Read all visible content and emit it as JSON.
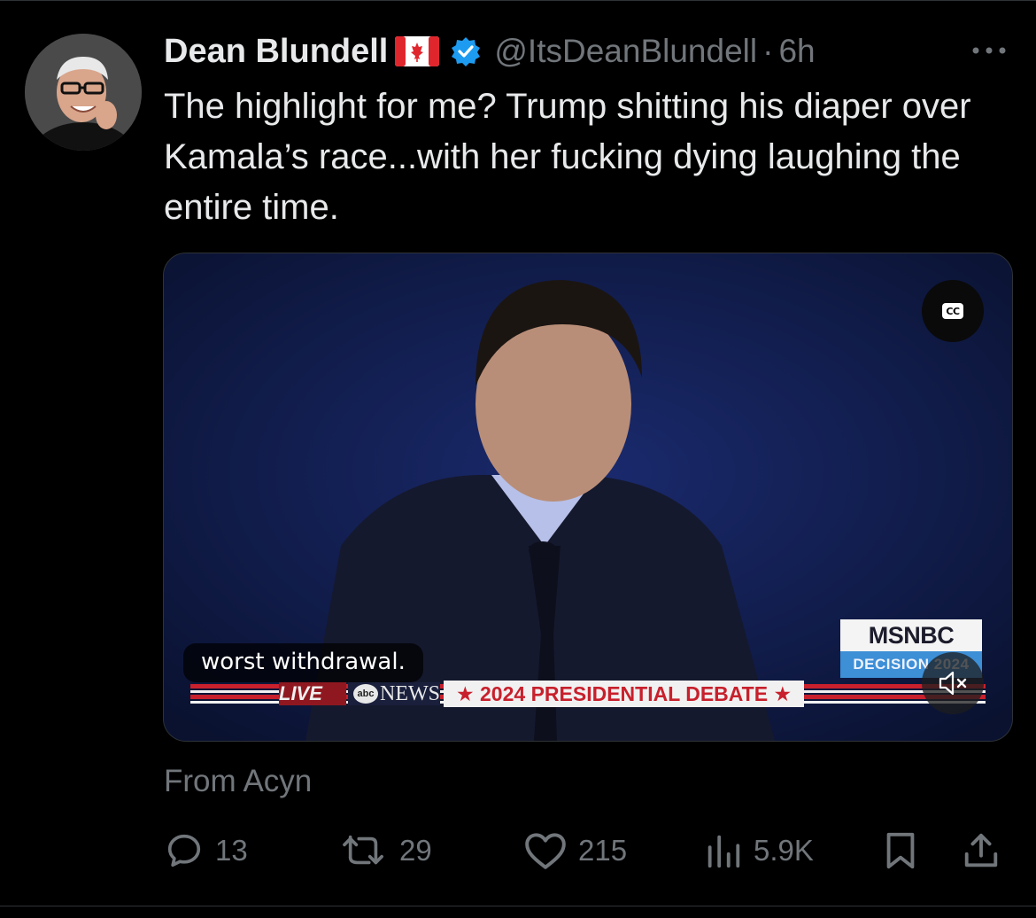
{
  "tweet": {
    "author_name": "Dean Blundell",
    "handle": "@ItsDeanBlundell",
    "separator": "·",
    "time": "6h",
    "text": "The highlight for me? Trump shitting his diaper over Kamala’s race...with her fucking dying laughing the entire time.",
    "source": "From Acyn"
  },
  "video": {
    "caption": "worst withdrawal.",
    "live_label": "LIVE",
    "network_label": "NEWS",
    "network_logo": "abc",
    "debate_banner": "★ 2024 PRESIDENTIAL DEBATE ★",
    "msnbc_label": "MSNBC",
    "msnbc_sub": "DECISION 2024",
    "cc_label": "CC"
  },
  "actions": {
    "replies": "13",
    "reposts": "29",
    "likes": "215",
    "views": "5.9K"
  },
  "colors": {
    "background": "#000000",
    "text_primary": "#e7e9ea",
    "text_secondary": "#71767b",
    "verified_blue": "#1d9bf0"
  },
  "icons": [
    "canada-flag-icon",
    "verified-badge-icon",
    "more-icon",
    "cc-icon",
    "mute-icon",
    "reply-icon",
    "repost-icon",
    "like-icon",
    "views-icon",
    "bookmark-icon",
    "share-icon"
  ]
}
